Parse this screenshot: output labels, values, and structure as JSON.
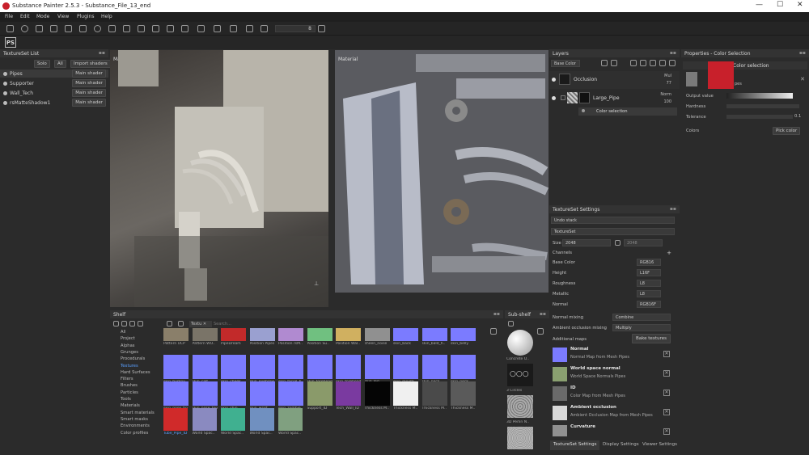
{
  "window": {
    "title": "Substance Painter 2.5.3 - Substance_File_13_end",
    "minimize": "—",
    "maximize": "☐",
    "close": "✕"
  },
  "menu": [
    "File",
    "Edit",
    "Mode",
    "View",
    "Plugins",
    "Help"
  ],
  "toolbar": {
    "brush_size": "8",
    "ps_label": "PS"
  },
  "textureset_list": {
    "title": "TextureSet List",
    "solo": "Solo",
    "all": "All",
    "import_shaders": "Import shaders",
    "items": [
      {
        "name": "Pipes",
        "shader": "Main shader"
      },
      {
        "name": "Supporter",
        "shader": "Main shader"
      },
      {
        "name": "Wall_Tech",
        "shader": "Main shader"
      },
      {
        "name": "rsMatteShadow1",
        "shader": "Main shader"
      }
    ]
  },
  "viewport3d": {
    "label": "Material"
  },
  "viewport2d": {
    "label": "Material"
  },
  "layers": {
    "title": "Layers",
    "channel": "Base Color",
    "items": [
      {
        "name": "Occlusion",
        "blend": "Mul",
        "opacity": "77"
      },
      {
        "name": "Large_Pipe",
        "blend": "Norm",
        "opacity": "100"
      },
      {
        "name": "Color selection",
        "blend": "",
        "opacity": ""
      }
    ]
  },
  "properties": {
    "title": "Properties - Color Selection",
    "section": "Color selection",
    "output_value_label": "Output value",
    "hardness_label": "Hardness",
    "tolerance_label": "Tolerance",
    "tolerance_value": "0.1",
    "colors_label": "Colors",
    "pick_color": "Pick color",
    "swatch_label": "pes"
  },
  "textureset_settings": {
    "title": "TextureSet Settings",
    "undo_stack": "Undo stack",
    "textureset": "TextureSet",
    "size_label": "Size",
    "size_value": "2048",
    "size_value2": "2048",
    "channels_label": "Channels",
    "channels": [
      {
        "name": "Base Color",
        "format": "RGB16"
      },
      {
        "name": "Height",
        "format": "L16F"
      },
      {
        "name": "Roughness",
        "format": "L8"
      },
      {
        "name": "Metallic",
        "format": "L8"
      },
      {
        "name": "Normal",
        "format": "RGB16F"
      }
    ],
    "normal_mixing_label": "Normal mixing",
    "normal_mixing_value": "Combine",
    "ao_mixing_label": "Ambient occlusion mixing",
    "ao_mixing_value": "Multiply",
    "additional_maps_label": "Additional maps",
    "bake_textures": "Bake textures",
    "maps": [
      {
        "name": "Normal",
        "desc": "Normal Map from Mesh Pipes",
        "color": "#7b7bff"
      },
      {
        "name": "World space normal",
        "desc": "World Space Normals Pipes",
        "color": "#8aa070"
      },
      {
        "name": "ID",
        "desc": "Color Map from Mesh Pipes",
        "color": "#6a6a6a"
      },
      {
        "name": "Ambient occlusion",
        "desc": "Ambient Occlusion Map from Mesh Pipes",
        "color": "#d8d8d8"
      },
      {
        "name": "Curvature",
        "desc": "",
        "color": "#909090"
      }
    ]
  },
  "bottom_tabs": [
    "TextureSet Settings",
    "Display Settings",
    "Viewer Settings"
  ],
  "shelf": {
    "title": "Shelf",
    "filter_tag": "Textu",
    "search_placeholder": "Search...",
    "categories": [
      "All",
      "Project",
      "Alphas",
      "Grunges",
      "Procedurals",
      "Textures",
      "Hard Surfaces",
      "Filters",
      "Brushes",
      "Particles",
      "Tools",
      "Materials",
      "Smart materials",
      "Smart masks",
      "Environments",
      "Color profiles"
    ],
    "active_category": "Textures",
    "thumbs": [
      {
        "label": "Pattern UCP",
        "color": "#8a7f6a"
      },
      {
        "label": "Pattern WO..",
        "color": "#7a7468"
      },
      {
        "label": "PipeDream",
        "color": "#c22a2a"
      },
      {
        "label": "Position Pipes",
        "color": "#9aa0d0"
      },
      {
        "label": "Position rsM..",
        "color": "#b08ad0"
      },
      {
        "label": "Position Su..",
        "color": "#70c080"
      },
      {
        "label": "Position Wal..",
        "color": "#d0b060"
      },
      {
        "label": "sheen_noise",
        "color": "#909090"
      },
      {
        "label": "skin_back",
        "color": "#7b7bff"
      },
      {
        "label": "skin_bald_h..",
        "color": "#7b7bff"
      },
      {
        "label": "skin_belly",
        "color": "#7b7bff"
      },
      {
        "label": "skin_bumpy",
        "color": "#7b7bff"
      },
      {
        "label": "skin_calf",
        "color": "#7b7bff"
      },
      {
        "label": "skin_cheek",
        "color": "#7b7bff"
      },
      {
        "label": "skin_eyebrow",
        "color": "#7b7bff"
      },
      {
        "label": "skin_facial_h..",
        "color": "#7b7bff"
      },
      {
        "label": "skin_forehead",
        "color": "#7b7bff"
      },
      {
        "label": "skin_forehead",
        "color": "#7b7bff"
      },
      {
        "label": "skin_leg",
        "color": "#7b7bff"
      },
      {
        "label": "skin_mouth",
        "color": "#7b7bff"
      },
      {
        "label": "skin_neck",
        "color": "#7b7bff"
      },
      {
        "label": "skin_neck",
        "color": "#7b7bff"
      },
      {
        "label": "skin_nose_tip",
        "color": "#7b7bff"
      },
      {
        "label": "skin_nose_top",
        "color": "#7b7bff"
      },
      {
        "label": "skin_shin",
        "color": "#7b7bff"
      },
      {
        "label": "skin_wrist",
        "color": "#7b7bff"
      },
      {
        "label": "skin_zombie",
        "color": "#7b7bff"
      },
      {
        "label": "Support_ID",
        "color": "#8a9a6a"
      },
      {
        "label": "Tech_Wall_ID",
        "color": "#7a3aa0"
      },
      {
        "label": "Thickness M..",
        "color": "#050505"
      },
      {
        "label": "Thickness M..",
        "color": "#f0f0f0"
      },
      {
        "label": "Thickness M..",
        "color": "#4a4a4a"
      },
      {
        "label": "Thickness M..",
        "color": "#5a5a5a"
      },
      {
        "label": "Tube_Pipe_ID",
        "color": "#d02a2a"
      },
      {
        "label": "World Spac..",
        "color": "#8a8ac0"
      },
      {
        "label": "World Spac..",
        "color": "#40b090"
      },
      {
        "label": "World Spac..",
        "color": "#7090c0"
      },
      {
        "label": "World Spac..",
        "color": "#80a080"
      }
    ]
  },
  "subshelf": {
    "title": "Sub-shelf",
    "items": [
      {
        "label": "Concrete O..",
        "color": "#dedede"
      },
      {
        "label": "3 Circles",
        "color": "#1a1a1a"
      },
      {
        "label": "3D Perlin N..",
        "color": "#888888"
      },
      {
        "label": "",
        "color": "#999999"
      }
    ]
  }
}
